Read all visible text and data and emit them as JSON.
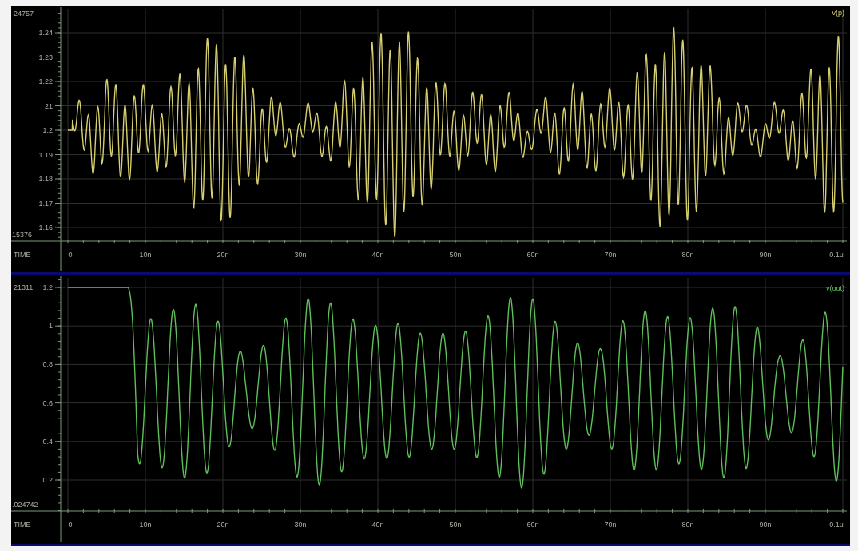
{
  "plots": [
    {
      "signal": "v(p)",
      "color": "#d8d070",
      "y_max_label": "24757",
      "y_min_label": "15376",
      "yticks": [
        "1.24",
        "1.23",
        "1.22",
        "21",
        "1.2",
        "1.19",
        "1.18",
        "1.17",
        "1.16"
      ],
      "xaxis_label": "TIME",
      "xticks": [
        "0",
        "10n",
        "20n",
        "30n",
        "40n",
        "50n",
        "60n",
        "70n",
        "80n",
        "90n",
        "0.1u"
      ]
    },
    {
      "signal": "v(out)",
      "color": "#5fbf5a",
      "y_max_label": "21311",
      "y_min_label": ".024742",
      "yticks": [
        "1.2",
        "1",
        "0.8",
        "0.6",
        "0.4",
        "0.2"
      ],
      "xaxis_label": "TIME",
      "xticks": [
        "0",
        "10n",
        "20n",
        "30n",
        "40n",
        "50n",
        "60n",
        "70n",
        "80n",
        "90n",
        "0.1u"
      ]
    }
  ]
}
